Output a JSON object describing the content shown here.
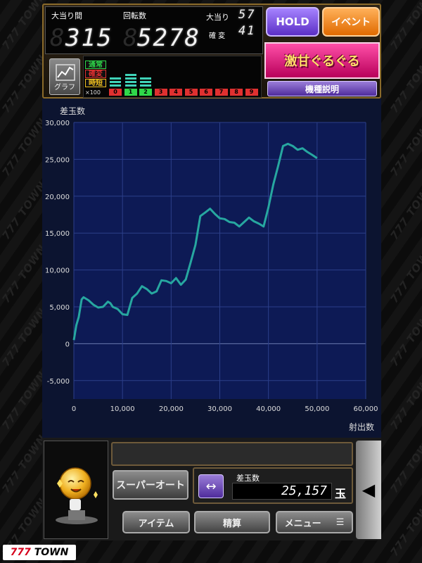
{
  "header": {
    "bonus_interval_label": "大当り間",
    "spins_label": "回転数",
    "bonus_interval_value": "315",
    "spins_value": "5278",
    "bonus_count_label": "大当り",
    "bonus_count_value": "57",
    "kakuhen_label": "確 変",
    "kakuhen_value": "41",
    "hold_button": "HOLD",
    "event_button": "イベント",
    "banner_title": "激甘ぐるぐる",
    "machine_info_button": "機種説明",
    "graph_button": "グラフ"
  },
  "history": {
    "tags": [
      {
        "label": "通常",
        "color": "#2fd84a"
      },
      {
        "label": "確変",
        "color": "#e03030"
      },
      {
        "label": "時短",
        "color": "#f0c020"
      }
    ],
    "scale_label": "×100",
    "columns": [
      {
        "num": "0",
        "level": 3,
        "color": "#e03030"
      },
      {
        "num": "1",
        "level": 4,
        "color": "#2fd84a"
      },
      {
        "num": "2",
        "level": 3,
        "color": "#2fd84a"
      },
      {
        "num": "3",
        "level": 0,
        "color": "#e03030"
      },
      {
        "num": "4",
        "level": 0,
        "color": "#e03030"
      },
      {
        "num": "5",
        "level": 0,
        "color": "#e03030"
      },
      {
        "num": "6",
        "level": 0,
        "color": "#e03030"
      },
      {
        "num": "7",
        "level": 0,
        "color": "#e03030"
      },
      {
        "num": "8",
        "level": 0,
        "color": "#e03030"
      },
      {
        "num": "9",
        "level": 0,
        "color": "#e03030"
      }
    ]
  },
  "chart_data": {
    "type": "line",
    "title": "差玉数",
    "xlabel": "射出数",
    "ylabel": "差玉数",
    "xlim": [
      0,
      60000
    ],
    "ylim": [
      -7500,
      30000
    ],
    "x_ticks": [
      "0",
      "10,000",
      "20,000",
      "30,000",
      "40,000",
      "50,000",
      "60,000"
    ],
    "y_ticks": [
      "30,000",
      "25,000",
      "20,000",
      "15,000",
      "10,000",
      "5,000",
      "0",
      "-5,000"
    ],
    "grid": true,
    "line_color": "#27a7a0",
    "series": [
      {
        "x": [
          0,
          500,
          1000,
          1600,
          2000,
          3000,
          4000,
          5000,
          6000,
          7000,
          7500,
          8000,
          9000,
          10000,
          11000,
          12000,
          13000,
          14000,
          15000,
          16000,
          17000,
          18000,
          19000,
          20000,
          21000,
          22000,
          23000,
          24000,
          25000,
          26000,
          27000,
          28000,
          29000,
          30000,
          31000,
          32000,
          33000,
          34000,
          35000,
          36000,
          37000,
          38000,
          39000,
          40000,
          41000,
          42000,
          43000,
          44000,
          45000,
          46000,
          47000,
          48000,
          49000,
          50000
        ],
        "y": [
          500,
          2500,
          3600,
          6000,
          6300,
          5900,
          5300,
          4900,
          5000,
          5700,
          5500,
          5000,
          4700,
          4000,
          3900,
          6200,
          6800,
          7800,
          7400,
          6800,
          7100,
          8600,
          8500,
          8200,
          8900,
          8000,
          8700,
          11000,
          13400,
          17300,
          17800,
          18300,
          17600,
          17000,
          16900,
          16500,
          16400,
          15900,
          16500,
          17100,
          16600,
          16300,
          15900,
          18500,
          21600,
          24100,
          26800,
          27100,
          26800,
          26300,
          26500,
          26000,
          25600,
          25157
        ]
      }
    ]
  },
  "footer": {
    "auto_button": "スーパーオート",
    "swap_icon": "↔",
    "diff_label": "差玉数",
    "diff_value": "25,157",
    "diff_unit": "玉",
    "item_button": "アイテム",
    "settle_button": "精算",
    "menu_button": "メニュー",
    "menu_icon": "☰",
    "side_tab_icon": "◀"
  },
  "logo": {
    "number": "777",
    "name": "TOWN"
  }
}
